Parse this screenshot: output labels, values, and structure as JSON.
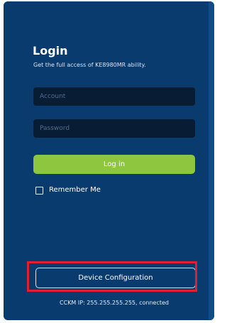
{
  "login": {
    "title": "Login",
    "subtitle": "Get the full access of KE8980MR ability.",
    "account_placeholder": "Account",
    "password_placeholder": "Password",
    "login_label": "Log in",
    "remember_label": "Remember Me",
    "remember_checked": false
  },
  "footer": {
    "device_config_label": "Device Configuration",
    "status_text": "CCKM IP: 255.255.255.255, connected"
  },
  "colors": {
    "panel_background": "#0a3b6e",
    "field_background": "#081c33",
    "primary_button": "#8dc63f",
    "highlight": "#e0202e"
  }
}
